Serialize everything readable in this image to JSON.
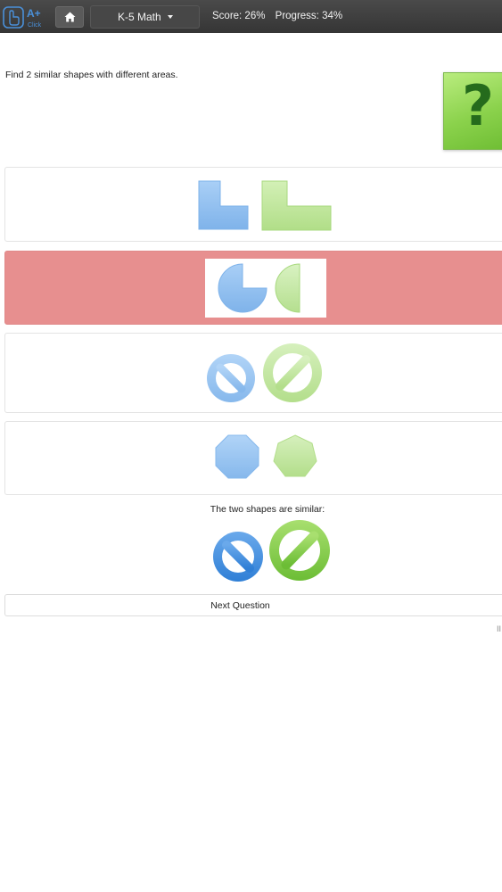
{
  "header": {
    "logo_text": "A+",
    "logo_subtext": "Click",
    "subject_label": "K-5 Math",
    "score_text": "Score: 26%",
    "progress_text": "Progress: 34%"
  },
  "question": {
    "text": "Find 2 similar shapes with different areas.",
    "help_symbol": "?"
  },
  "options": [
    {
      "shapes": [
        "l-shape-small",
        "l-shape-large"
      ],
      "state": "default"
    },
    {
      "shapes": [
        "circle-sector-three-quarter",
        "half-circle"
      ],
      "state": "selected-wrong"
    },
    {
      "shapes": [
        "no-sign-small",
        "no-sign-large"
      ],
      "state": "default"
    },
    {
      "shapes": [
        "octagon",
        "heptagon"
      ],
      "state": "default"
    }
  ],
  "answer": {
    "label": "The two shapes are similar:",
    "shapes": [
      "no-sign-small",
      "no-sign-large"
    ]
  },
  "next_button_label": "Next Question",
  "edge_mark": "II",
  "colors": {
    "topbar": "#3d3d3d",
    "blue_shape": "#8dbdf0",
    "green_shape": "#bde39a",
    "wrong_highlight": "#e78f8f",
    "help_green": "#8bd24c"
  }
}
